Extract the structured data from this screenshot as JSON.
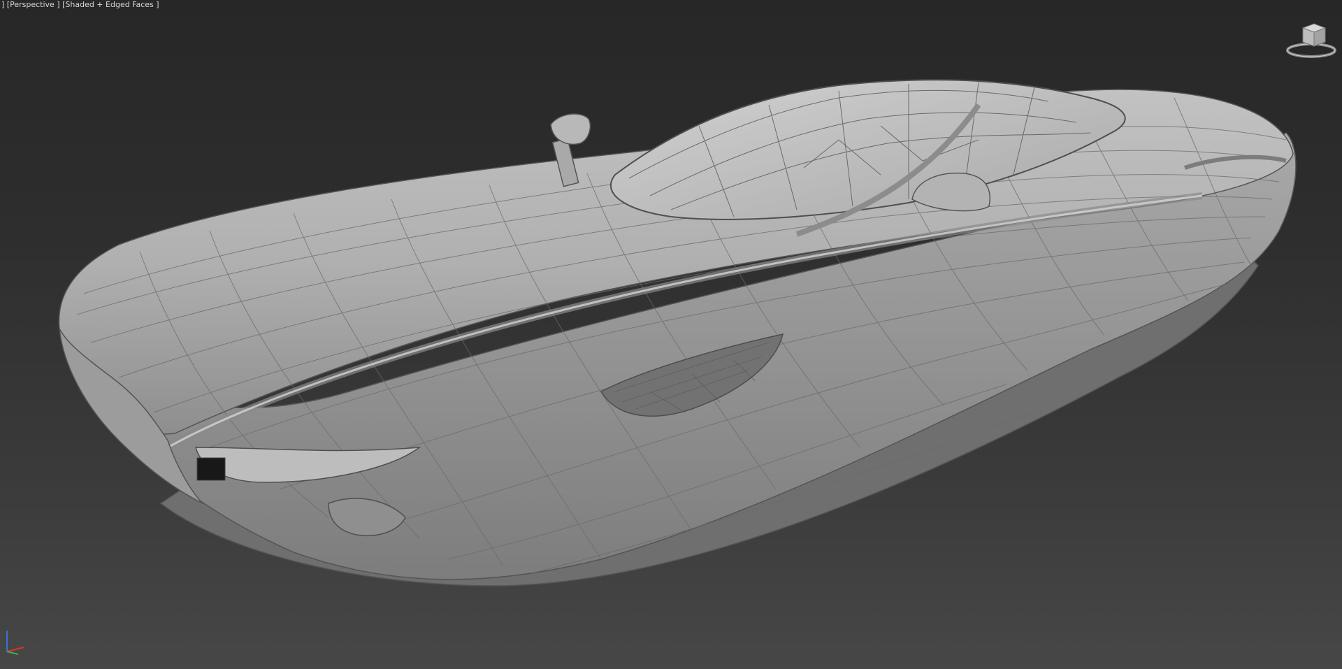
{
  "viewport": {
    "bracket_open": "] ",
    "view_label": "[Perspective ]",
    "shading_label": "[Shaded + Edged Faces ]",
    "background_top": "#272727",
    "background_bottom": "#474747"
  },
  "viewcube": {
    "icon": "viewcube-icon"
  },
  "axis_tripod": {
    "icon": "axis-tripod-icon",
    "x_color": "#d9342b",
    "y_color": "#3fae49",
    "z_color": "#3b6fd6"
  },
  "model": {
    "icon": "car-model-mesh",
    "surface_color": "#b9b9b9",
    "edge_color": "#5a5a5a"
  }
}
